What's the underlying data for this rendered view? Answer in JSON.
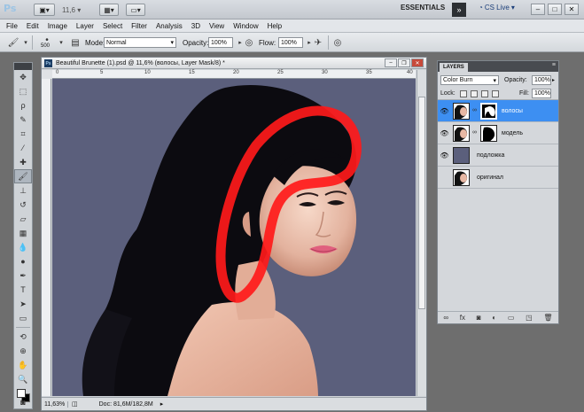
{
  "app": {
    "logo": "Ps",
    "zoom_display": "11,6",
    "zoom_caret": "▾",
    "workspace": "ESSENTIALS",
    "more": "»",
    "cslive": "CS Live",
    "win_min": "–",
    "win_max": "□",
    "win_close": "✕"
  },
  "menu": [
    "File",
    "Edit",
    "Image",
    "Layer",
    "Select",
    "Filter",
    "Analysis",
    "3D",
    "View",
    "Window",
    "Help"
  ],
  "options": {
    "brush_size": "500",
    "mode_label": "Mode:",
    "mode_value": "Normal",
    "opacity_label": "Opacity:",
    "opacity_value": "100%",
    "flow_label": "Flow:",
    "flow_value": "100%"
  },
  "document": {
    "title": "Beautiful Brunette (1).psd @ 11,6% (волосы, Layer Mask/8) *",
    "zoom": "11,63%",
    "doc_size": "Doc: 81,6M/182,8M",
    "ruler_marks": [
      "0",
      "5",
      "10",
      "15",
      "20",
      "25",
      "30",
      "35",
      "40"
    ]
  },
  "layers_panel": {
    "tab": "LAYERS",
    "blend_mode": "Color Burn",
    "opacity_label": "Opacity:",
    "opacity_value": "100%",
    "lock_label": "Lock:",
    "fill_label": "Fill:",
    "fill_value": "100%",
    "layers": [
      {
        "name": "волосы",
        "visible": true,
        "selected": true,
        "has_mask": true
      },
      {
        "name": "модель",
        "visible": true,
        "selected": false,
        "has_mask": true
      },
      {
        "name": "подложка",
        "visible": true,
        "selected": false,
        "has_mask": false
      },
      {
        "name": "оригинал",
        "visible": false,
        "selected": false,
        "has_mask": false
      }
    ]
  },
  "colors": {
    "canvas_bg": "#5b5f7c",
    "selected_layer": "#3d8ff2",
    "brush_stroke": "#ff1a1a"
  }
}
